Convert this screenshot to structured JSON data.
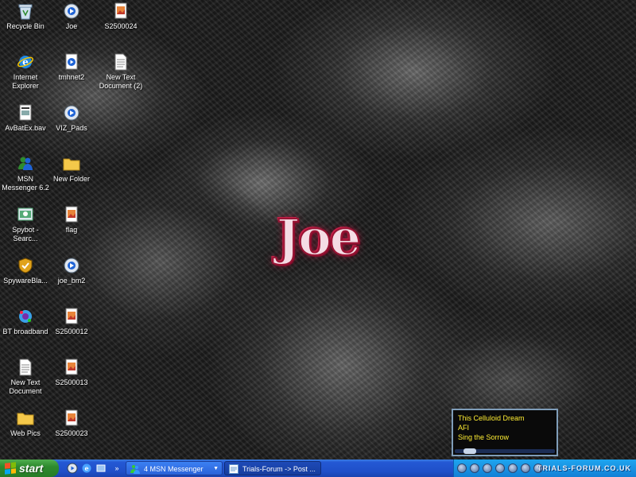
{
  "desktop": {
    "logo_text": "Joe",
    "icons": [
      {
        "label": "Recycle Bin",
        "icon": "recycle-bin-icon"
      },
      {
        "label": "Internet\nExplorer",
        "icon": "internet-explorer-icon"
      },
      {
        "label": "AvBatEx.bav",
        "icon": "file-icon"
      },
      {
        "label": "MSN\nMessenger 6.2",
        "icon": "msn-messenger-icon"
      },
      {
        "label": "Spybot -\nSearc...",
        "icon": "spybot-icon"
      },
      {
        "label": "SpywareBla...",
        "icon": "spywareblaster-icon"
      },
      {
        "label": "BT broadband",
        "icon": "bt-broadband-icon"
      },
      {
        "label": "New Text\nDocument",
        "icon": "text-document-icon"
      },
      {
        "label": "Web Pics",
        "icon": "folder-icon"
      },
      {
        "label": "Joe",
        "icon": "media-file-icon"
      },
      {
        "label": "tmhnet2",
        "icon": "video-file-icon"
      },
      {
        "label": "VIZ_Pads",
        "icon": "media-file-icon"
      },
      {
        "label": "New Folder",
        "icon": "folder-icon"
      },
      {
        "label": "flag",
        "icon": "image-file-icon"
      },
      {
        "label": "joe_bm2",
        "icon": "media-file-icon"
      },
      {
        "label": "S2500012",
        "icon": "image-file-icon"
      },
      {
        "label": "S2500013",
        "icon": "image-file-icon"
      },
      {
        "label": "S2500023",
        "icon": "image-file-icon"
      },
      {
        "label": "S2500024",
        "icon": "image-file-icon"
      },
      {
        "label": "New Text\nDocument (2)",
        "icon": "text-document-icon"
      }
    ]
  },
  "media_player": {
    "track_title": "This Celluloid Dream",
    "artist": "AFI",
    "album": "Sing the Sorrow",
    "seek_progress": 0.1
  },
  "taskbar": {
    "start_label": "start",
    "buttons": [
      {
        "label": "4 MSN Messenger"
      },
      {
        "label": "Trials-Forum -> Post ..."
      }
    ],
    "watermark": "TRIALS-FORUM.CO.UK"
  },
  "colors": {
    "taskbar_blue": "#2459d4",
    "start_green": "#2e8b2e",
    "player_text": "#ffee33",
    "logo_red": "#9a1434"
  }
}
